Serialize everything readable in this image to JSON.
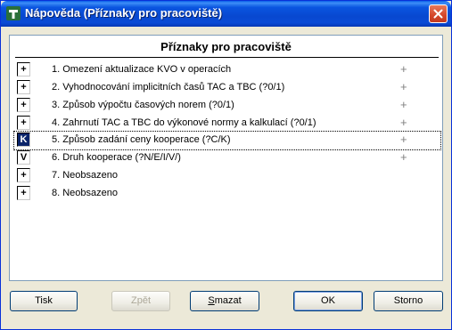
{
  "window": {
    "title": "Nápověda (Příznaky pro pracoviště)",
    "icon": "app-t-icon",
    "close_icon": "close-x-icon"
  },
  "panel": {
    "title": "Příznaky pro pracoviště",
    "rows": [
      {
        "check": "+",
        "text": "1.  Omezení aktualizace KVO v operacích",
        "plus": "+"
      },
      {
        "check": "+",
        "text": "2.  Vyhodnocování implicitních časů TAC a TBC (?0/1)",
        "plus": "+"
      },
      {
        "check": "+",
        "text": "3.  Způsob výpočtu časových norem (?0/1)",
        "plus": "+"
      },
      {
        "check": "+",
        "text": "4.  Zahrnutí TAC a TBC do výkonové normy a kalkulací (?0/1)",
        "plus": "+"
      },
      {
        "check": "K",
        "text": "5.  Způsob zadání ceny kooperace (?C/K)",
        "plus": "+"
      },
      {
        "check": "V",
        "text": "6.  Druh kooperace (?N/E/I/V/)",
        "plus": "+"
      },
      {
        "check": "+",
        "text": "7.  Neobsazeno",
        "plus": ""
      },
      {
        "check": "+",
        "text": "8.  Neobsazeno",
        "plus": ""
      }
    ]
  },
  "buttons": {
    "print": "Tisk",
    "back": "Zpět",
    "clear_first": "S",
    "clear_rest": "mazat",
    "ok": "OK",
    "cancel": "Storno"
  }
}
